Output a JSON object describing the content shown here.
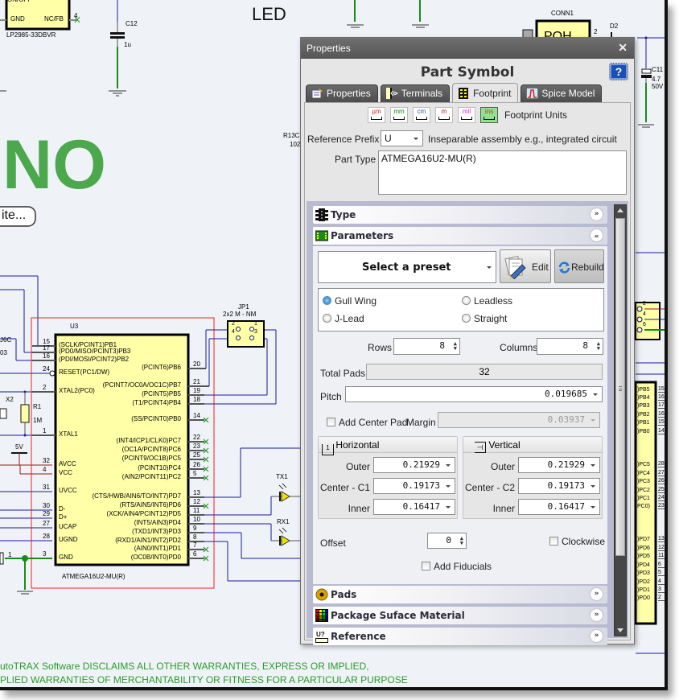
{
  "schematic": {
    "title_led": "LED",
    "big_text": "NO",
    "pill_text": "ite...",
    "lp_part": "LP2985-33DBVR",
    "lp_pins": {
      "gnd": "GND",
      "nc": "NC/FB",
      "onoff": "ON/OFF",
      "pin4": "4"
    },
    "c12": {
      "ref": "C12",
      "value": "1u"
    },
    "c11": {
      "ref": "C11",
      "value1": "4.7",
      "value2": "50V"
    },
    "conn1": {
      "ref": "CONN1",
      "body": "POH",
      "pin": "2"
    },
    "d2": "D2",
    "r13c": {
      "ref": "R13C",
      "value": "102"
    },
    "jp1": {
      "ref": "JP1",
      "value": "2x2 M - NM",
      "pins": [
        "2",
        "1",
        "4",
        "3"
      ]
    },
    "u3": {
      "ref": "U3",
      "part": "ATMEGA16U2-MU(R)",
      "left_pins": [
        {
          "num": "15",
          "name": "(SCLK/PCINT1)PB1"
        },
        {
          "num": "17",
          "name": "(PD0/MISO/PCINT3)PB3"
        },
        {
          "num": "16",
          "name": "(PDI/MOSI/PCINT2)PB2"
        },
        {
          "num": "24",
          "name": "RESET(PC1/DW)"
        },
        {
          "num": "2",
          "name": "XTAL2(PC0)"
        },
        {
          "num": "1",
          "name": "XTAL1"
        },
        {
          "num": "32",
          "name": "AVCC"
        },
        {
          "num": "4",
          "name": "VCC"
        },
        {
          "num": "31",
          "name": "UVCC"
        },
        {
          "num": "30",
          "name": "D-"
        },
        {
          "num": "29",
          "name": "D+"
        },
        {
          "num": "27",
          "name": "UCAP"
        },
        {
          "num": "28",
          "name": "UGND"
        },
        {
          "num": "3",
          "name": "GND"
        }
      ],
      "right_pins": [
        {
          "num": "20",
          "name": "(PCINT6)PB6"
        },
        {
          "num": "21",
          "name": "(PCINT7/OC0A/OC1C)PB7"
        },
        {
          "num": "19",
          "name": "(PCINT5)PB5"
        },
        {
          "num": "18",
          "name": "(T1/PCINT4)PB4"
        },
        {
          "num": "14",
          "name": "(SS/PCINT0)PB0"
        },
        {
          "num": "22",
          "name": "(INT4/ICP1/CLK0)PC7"
        },
        {
          "num": "23",
          "name": "(OC1A/PCINT8)PC6"
        },
        {
          "num": "25",
          "name": "(PCINT9/OC1B)PC5"
        },
        {
          "num": "26",
          "name": "(PCINT10)PC4"
        },
        {
          "num": "5",
          "name": "(AIN2/PCINT11)PC2"
        },
        {
          "num": "13",
          "name": "(CTS/HWB/AIN6/TO/INT7)PD7"
        },
        {
          "num": "12",
          "name": "(RTS/AIN5/INT6)PD6"
        },
        {
          "num": "11",
          "name": "(XCK/AIN4/PCINT12)PD5"
        },
        {
          "num": "10",
          "name": "(INT5/AIN3)PD4"
        },
        {
          "num": "9",
          "name": "(TXD1/INT3)PD3"
        },
        {
          "num": "8",
          "name": "(RXD1/AIN1/INT2)PD2"
        },
        {
          "num": "7",
          "name": "(AIN0/INT1)PD1"
        },
        {
          "num": "6",
          "name": "(OC0B/INT0)PD0"
        }
      ]
    },
    "x2": "X2",
    "r1": {
      "ref": "R1",
      "value": "1M"
    },
    "v5": "5V",
    "left_labels": [
      "J6C",
      "03"
    ],
    "tx1": "TX1",
    "rx1": "RX1",
    "gnd_pin": "1",
    "right_chip_pins": [
      {
        "name": ")PB5",
        "num": "15"
      },
      {
        "name": ")PB4",
        "num": "16"
      },
      {
        "name": ")PB3",
        "num": "17"
      },
      {
        "name": ")PB2",
        "num": "16"
      },
      {
        "name": ")PB1",
        "num": "15"
      },
      {
        "name": ")PB0",
        "num": "14"
      },
      {
        "name": ")PC5",
        "num": "28"
      },
      {
        "name": ")PC4",
        "num": "27"
      },
      {
        "name": ")PC3",
        "num": "26"
      },
      {
        "name": ")PC2",
        "num": "25"
      },
      {
        "name": ")PC1",
        "num": "24"
      },
      {
        "name": "PC0)",
        "num": "23"
      },
      {
        "name": ")PD7",
        "num": "13"
      },
      {
        "name": ")PD6",
        "num": "12"
      },
      {
        "name": ")PD5",
        "num": "11"
      },
      {
        "name": ")PD4",
        "num": "6"
      },
      {
        "name": ")PD3",
        "num": "5"
      },
      {
        "name": ")PD2",
        "num": "4"
      },
      {
        "name": ")PD1",
        "num": "3"
      },
      {
        "name": ")PD0",
        "num": "2"
      }
    ],
    "right_conn_pins": [
      "2",
      "4",
      "6"
    ],
    "disclaimer_line1": "utoTRAX Software DISCLAIMS ALL OTHER WARRANTIES, EXPRESS OR IMPLIED,",
    "disclaimer_line2": "PLIED WARRANTIES OF MERCHANTABILITY OR FITNESS FOR A PARTICULAR PURPOSE"
  },
  "properties": {
    "window_title": "Properties",
    "heading": "Part Symbol",
    "help_icon": "?",
    "tabs": [
      {
        "label": "Properties",
        "icon": "properties-icon"
      },
      {
        "label": "Terminals",
        "icon": "terminals-icon"
      },
      {
        "label": "Footprint",
        "icon": "footprint-icon",
        "active": true
      },
      {
        "label": "Spice Model",
        "icon": "spice-model-icon"
      }
    ],
    "units": [
      {
        "label": "µm",
        "color": "#d02020"
      },
      {
        "label": "mm",
        "color": "#108010"
      },
      {
        "label": "cm",
        "color": "#3050b0"
      },
      {
        "label": "m",
        "color": "#a02020"
      },
      {
        "label": "mil",
        "color": "#d020d0"
      },
      {
        "label": "ins",
        "color": "#a05010",
        "active": true
      }
    ],
    "units_label": "Footprint Units",
    "reference_prefix_label": "Reference Prefix",
    "reference_prefix_value": "U",
    "reference_prefix_desc": "Inseparable assembly e.g., integrated circuit",
    "part_type_label": "Part Type",
    "part_type_value": "ATMEGA16U2-MU(R)",
    "sections": {
      "type": "Type",
      "parameters": "Parameters",
      "pads": "Pads",
      "surface": "Package Suface Material",
      "reference": "Reference"
    },
    "preset": {
      "value": "Select a preset",
      "edit": "Edit",
      "rebuild": "Rebuild"
    },
    "lead_types": [
      {
        "label": "Gull Wing",
        "checked": true
      },
      {
        "label": "Leadless",
        "checked": false
      },
      {
        "label": "J-Lead",
        "checked": false
      },
      {
        "label": "Straight",
        "checked": false
      }
    ],
    "rows_label": "Rows",
    "rows_value": "8",
    "columns_label": "Columns",
    "columns_value": "8",
    "total_pads_label": "Total Pads",
    "total_pads_value": "32",
    "pitch_label": "Pitch",
    "pitch_value": "0.019685",
    "center_pad_label": "Add Center Pad",
    "margin_label": "Margin",
    "margin_value": "0.03937",
    "horizontal": {
      "title": "Horizontal",
      "icon_text": "1",
      "outer_label": "Outer",
      "outer": "0.21929",
      "center_label": "Center - C1",
      "center": "0.19173",
      "inner_label": "Inner",
      "inner": "0.16417"
    },
    "vertical": {
      "title": "Vertical",
      "outer_label": "Outer",
      "outer": "0.21929",
      "center_label": "Center - C2",
      "center": "0.19173",
      "inner_label": "Inner",
      "inner": "0.16417"
    },
    "offset_label": "Offset",
    "offset_value": "0",
    "clockwise_label": "Clockwise",
    "fiducials_label": "Add Fiducials",
    "close_icon": "✕"
  }
}
